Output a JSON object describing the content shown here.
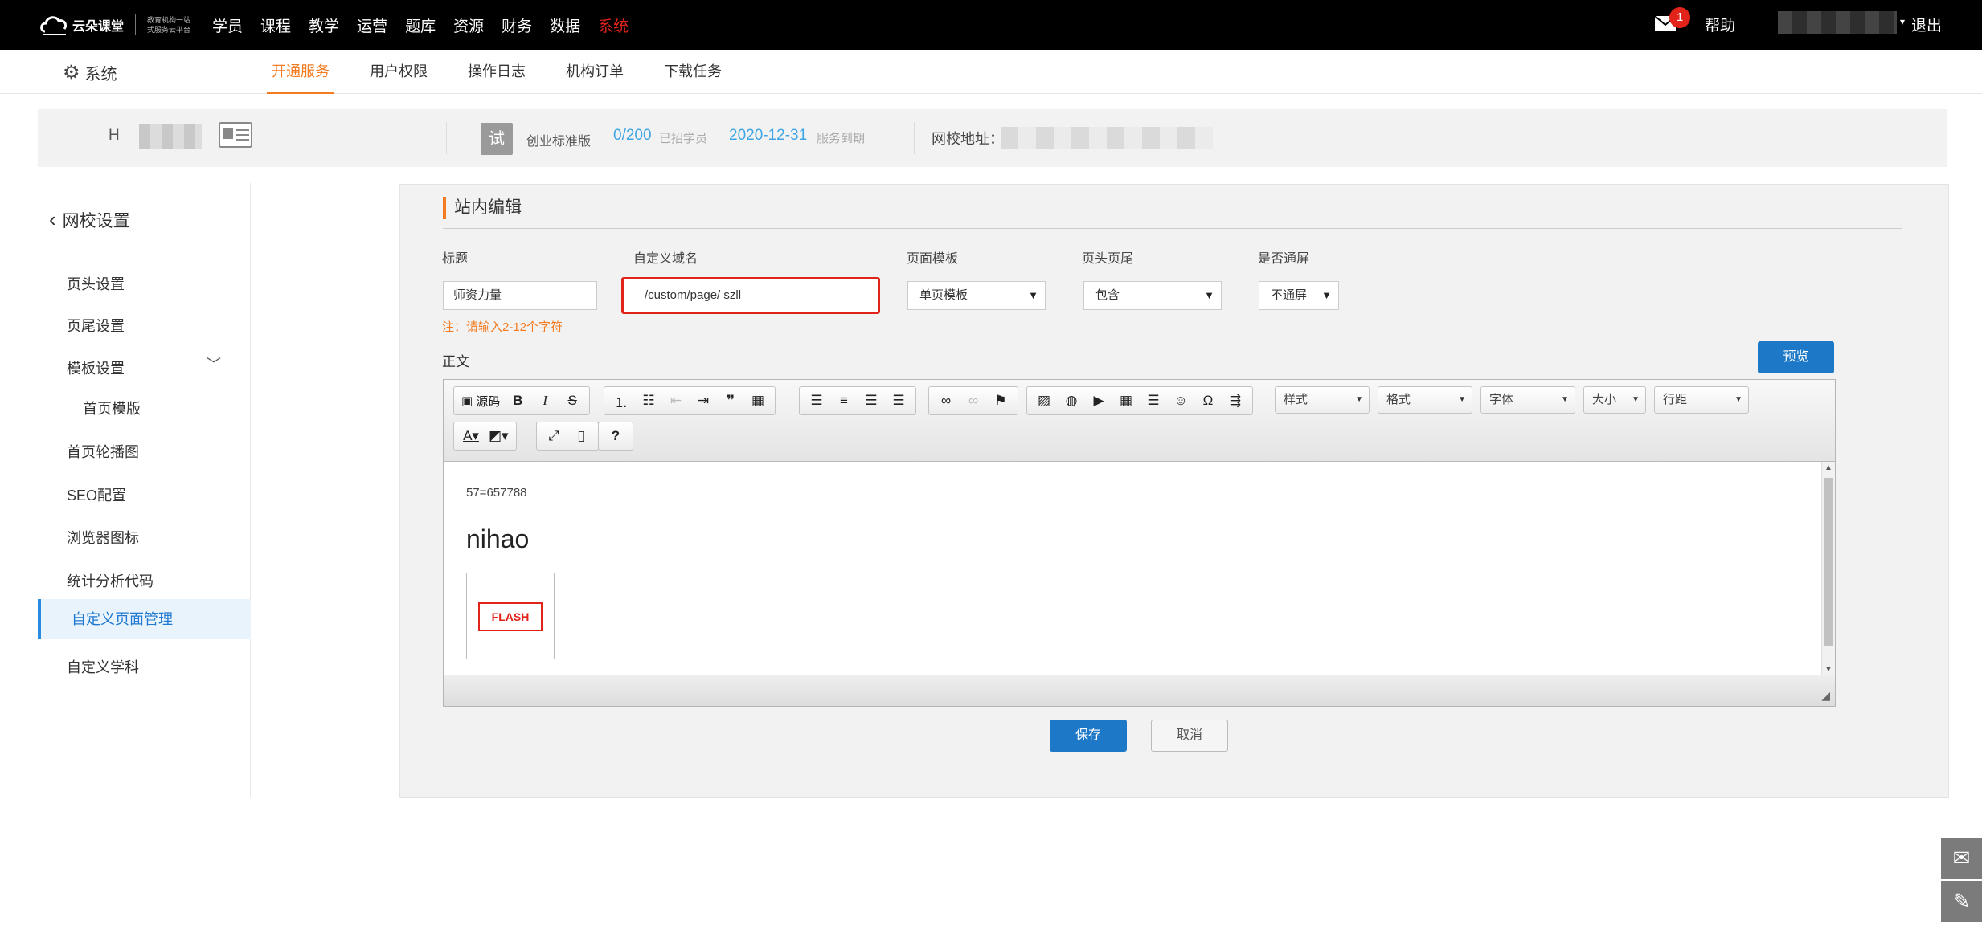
{
  "brand": {
    "name": "云朵课堂",
    "tagline": "教育机构一站式服务云平台"
  },
  "topnav": {
    "items": [
      "学员",
      "课程",
      "教学",
      "运营",
      "题库",
      "资源",
      "财务",
      "数据",
      "系统"
    ],
    "active_index": 8,
    "mail_badge": "1",
    "help": "帮助",
    "logout": "退出"
  },
  "subnav": {
    "system": "系统",
    "tabs": [
      "开通服务",
      "用户权限",
      "操作日志",
      "机构订单",
      "下载任务"
    ],
    "active_index": 0
  },
  "infobar": {
    "school_initial": "H",
    "trial_badge": "试",
    "edition": "创业标准版",
    "student_count": "0/200",
    "student_count_label": "已招学员",
    "expiry_date": "2020-12-31",
    "expiry_label": "服务到期",
    "address_label": "网校地址："
  },
  "sidebar": {
    "back_label": "网校设置",
    "items": [
      {
        "label": "页头设置"
      },
      {
        "label": "页尾设置"
      },
      {
        "label": "模板设置"
      },
      {
        "label": "首页模版"
      },
      {
        "label": "首页轮播图"
      },
      {
        "label": "SEO配置"
      },
      {
        "label": "浏览器图标"
      },
      {
        "label": "统计分析代码"
      },
      {
        "label": "自定义页面管理"
      },
      {
        "label": "自定义学科"
      }
    ]
  },
  "form": {
    "section_title": "站内编辑",
    "title_label": "标题",
    "title_value": "师资力量",
    "domain_label": "自定义域名",
    "domain_value": "/custom/page/  szll",
    "template_label": "页面模板",
    "template_value": "单页模板",
    "header_footer_label": "页头页尾",
    "header_footer_value": "包含",
    "fullscreen_label": "是否通屏",
    "fullscreen_value": "不通屏",
    "note": "注：请输入2-12个字符",
    "body_label": "正文",
    "preview": "预览",
    "save": "保存",
    "cancel": "取消"
  },
  "editor": {
    "source_label": "源码",
    "combos": [
      "样式",
      "格式",
      "字体",
      "大小",
      "行距"
    ],
    "content_line1": "57=657788",
    "content_line2": "nihao",
    "flash_label": "FLASH"
  }
}
